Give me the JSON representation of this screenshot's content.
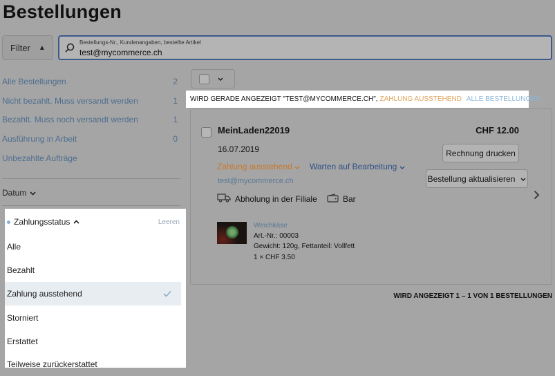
{
  "page": {
    "title": "Bestellungen"
  },
  "toolbar": {
    "filter_label": "Filter",
    "search_hint": "Bestellungs-Nr., Kundenangaben, bestellte Artikel",
    "search_value": "test@mycommerce.ch"
  },
  "sidebar": {
    "items": [
      {
        "label": "Alle Bestellungen",
        "count": "2"
      },
      {
        "label": "Nicht bezahlt. Muss versandt werden",
        "count": "1"
      },
      {
        "label": "Bezahlt. Muss noch versandt werden",
        "count": "1"
      },
      {
        "label": "Ausführung in Arbeit",
        "count": "0"
      },
      {
        "label": "Unbezahlte Aufträge",
        "count": ""
      }
    ],
    "date_filter": "Datum"
  },
  "status_filter": {
    "label": "Zahlungsstatus",
    "clear": "Leeren",
    "options": [
      "Alle",
      "Bezahlt",
      "Zahlung ausstehend",
      "Storniert",
      "Erstattet",
      "Teilweise zurückerstattet"
    ],
    "selected": "Zahlung ausstehend"
  },
  "results": {
    "showing_text": "WIRD GERADE ANGEZEIGT \"TEST@MYCOMMERCE.CH\",",
    "pending_link": "ZAHLUNG AUSSTEHEND",
    "all_link": "ALLE BESTELLUNGEN",
    "page_info": "WIRD ANGEZEIGT 1 – 1 VON 1 BESTELLUNGEN"
  },
  "order": {
    "shop": "MeinLaden22019",
    "price": "CHF 12.00",
    "date": "16.07.2019",
    "payment_status": "Zahlung ausstehend",
    "work_status": "Warten auf Bearbeitung",
    "email": "test@mycommerce.ch",
    "invoice_button": "Rechnung drucken",
    "update_button": "Bestellung aktualisieren",
    "delivery": "Abholung in der Filiale",
    "payment_method": "Bar",
    "item": {
      "name": "Weichkäse",
      "sku": "Art.-Nr.: 00003",
      "details": "Gewicht: 120g, Fettanteil: Vollfett",
      "qty_price": "1 × CHF 3.50"
    }
  },
  "colors": {
    "accent": "#3d5a8c",
    "pending": "#c97829",
    "link": "#587896"
  }
}
